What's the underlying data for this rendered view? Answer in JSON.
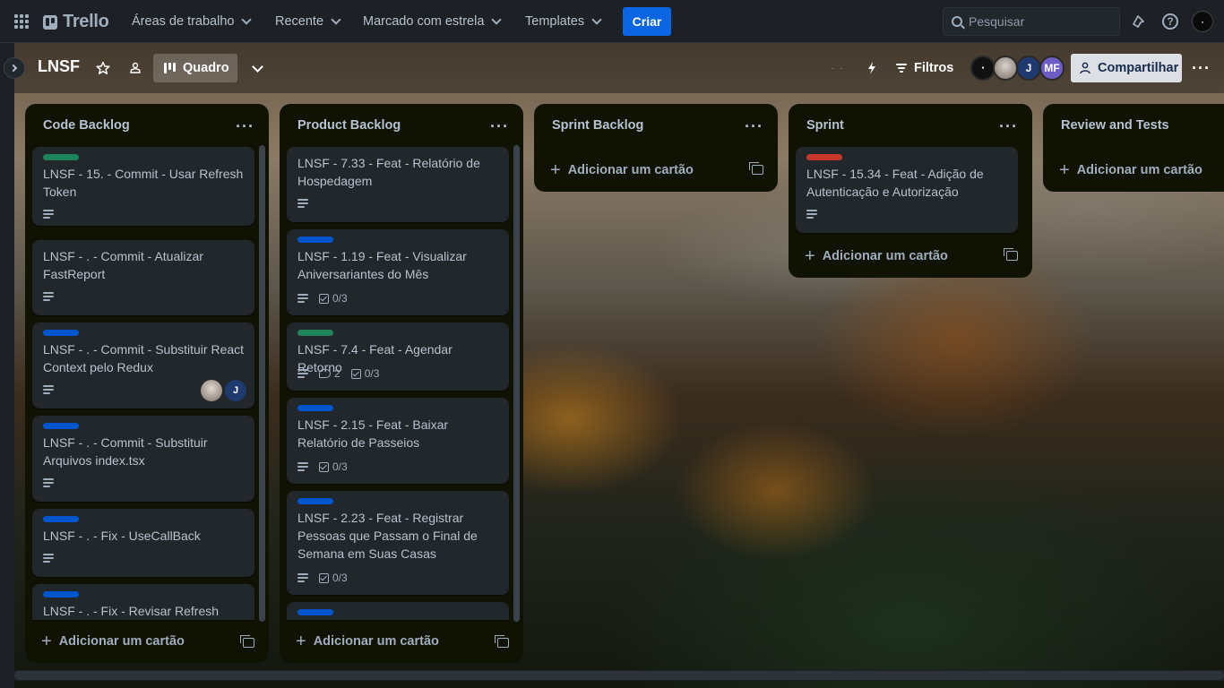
{
  "topnav": {
    "logo": "Trello",
    "menus": [
      "Áreas de trabalho",
      "Recente",
      "Marcado com estrela",
      "Templates"
    ],
    "create_label": "Criar",
    "search_placeholder": "Pesquisar"
  },
  "board": {
    "title": "LNSF",
    "view_label": "Quadro",
    "filters_label": "Filtros",
    "share_label": "Compartilhar",
    "members": [
      {
        "initials": "",
        "color": "#111111"
      },
      {
        "initials": "",
        "color": "#8a7d70"
      },
      {
        "initials": "J",
        "color": "#1f3a6e"
      },
      {
        "initials": "MF",
        "color": "#6e5dc6"
      }
    ]
  },
  "lists": [
    {
      "title": "Code Backlog",
      "add_label": "Adicionar um cartão",
      "cards": [
        {
          "label": "#1f845a",
          "title": "LNSF - 15. - Commit - Usar Refresh Token",
          "desc": true
        },
        {
          "label": null,
          "title": "LNSF - . - Commit - Atualizar FastReport",
          "desc": true
        },
        {
          "label": "#0055cc",
          "title": "LNSF - . - Commit - Substituir React Context pelo Redux",
          "desc": true,
          "avatars": [
            "",
            "J"
          ]
        },
        {
          "label": "#0055cc",
          "title": "LNSF - . - Commit - Substituir Arquivos index.tsx",
          "desc": true
        },
        {
          "label": "#0055cc",
          "title": "LNSF - . - Fix - UseCallBack",
          "desc": true
        },
        {
          "label": "#0055cc",
          "title": "LNSF - . - Fix - Revisar Refresh Token",
          "desc": false
        }
      ]
    },
    {
      "title": "Product Backlog",
      "add_label": "Adicionar um cartão",
      "cards": [
        {
          "label": null,
          "title": "LNSF - 7.33 - Feat - Relatório de Hospedagem",
          "desc": true
        },
        {
          "label": "#0055cc",
          "title": "LNSF - 1.19 - Feat - Visualizar Aniversariantes do Mês",
          "desc": true,
          "checklist": "0/3"
        },
        {
          "label": "#1f845a",
          "title": "LNSF - 7.4 - Feat - Agendar Retorno",
          "desc": true,
          "comments": "2",
          "checklist": "0/3"
        },
        {
          "label": "#0055cc",
          "title": "LNSF - 2.15 - Feat - Baixar Relatório de Passeios",
          "desc": true,
          "checklist": "0/3"
        },
        {
          "label": "#0055cc",
          "title": "LNSF - 2.23 - Feat - Registrar Pessoas que Passam o Final de Semana em Suas Casas",
          "desc": true,
          "checklist": "0/3"
        },
        {
          "label": "#0055cc",
          "title": "",
          "desc": false
        }
      ]
    },
    {
      "title": "Sprint Backlog",
      "add_label": "Adicionar um cartão",
      "cards": []
    },
    {
      "title": "Sprint",
      "add_label": "Adicionar um cartão",
      "cards": [
        {
          "label": "#c9372c",
          "title": "LNSF - 15.34 - Feat - Adição de Autenticação e Autorização",
          "desc": true
        }
      ]
    },
    {
      "title": "Review and Tests",
      "add_label": "Adicionar um cartão",
      "cards": []
    }
  ]
}
